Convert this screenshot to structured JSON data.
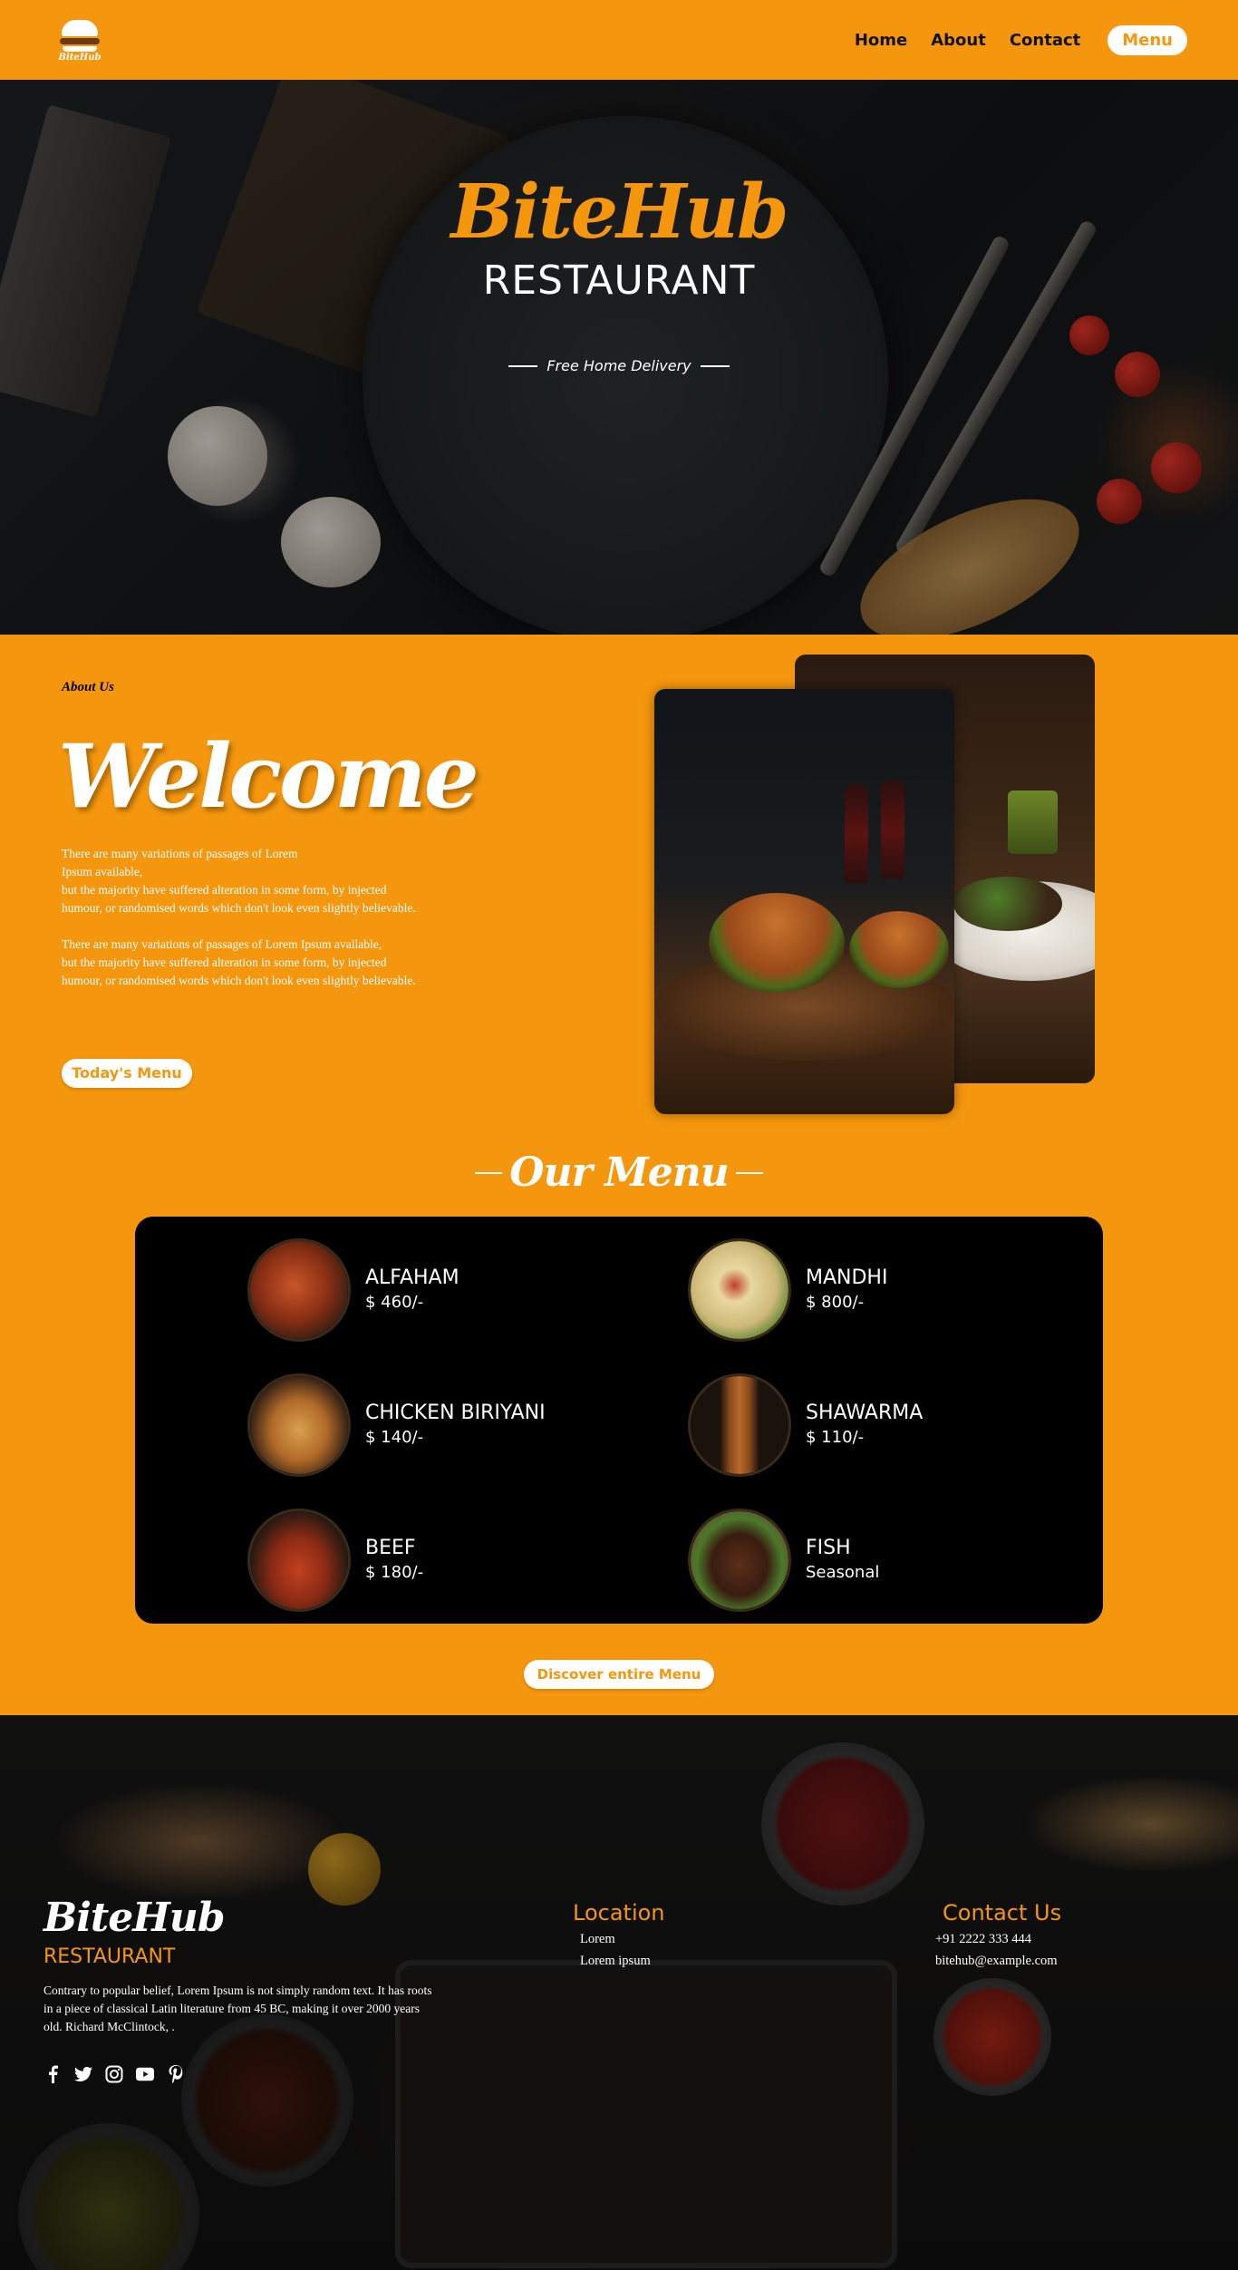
{
  "nav": {
    "logo_text": "BiteHub",
    "links": [
      "Home",
      "About",
      "Contact"
    ],
    "cta": "Menu"
  },
  "hero": {
    "title": "BiteHub",
    "subtitle": "RESTAURANT",
    "tagline": "Free Home Delivery"
  },
  "about": {
    "label": "About Us",
    "heading": "Welcome",
    "paragraph1": "There are many variations of passages of Lorem\nIpsum available,\nbut the majority have suffered alteration in some form, by injected\nhumour, or randomised words which don't look even slightly believable.",
    "paragraph2": "There are many variations of passages of Lorem Ipsum available,\nbut the majority have suffered alteration in some form, by injected\nhumour, or randomised words which don't look even slightly believable.",
    "button": "Today's Menu"
  },
  "menu": {
    "heading": "Our Menu",
    "items": [
      {
        "name": "ALFAHAM",
        "price": "$ 460/-",
        "icon": "alfaham-dish-image"
      },
      {
        "name": "MANDHI",
        "price": "$ 800/-",
        "icon": "mandhi-dish-image"
      },
      {
        "name": "CHICKEN BIRIYANI",
        "price": "$ 140/-",
        "icon": "biriyani-dish-image"
      },
      {
        "name": "SHAWARMA",
        "price": "$ 110/-",
        "icon": "shawarma-dish-image"
      },
      {
        "name": "BEEF",
        "price": "$ 180/-",
        "icon": "beef-dish-image"
      },
      {
        "name": "FISH",
        "price": "Seasonal",
        "icon": "fish-dish-image"
      }
    ],
    "button": "Discover entire Menu"
  },
  "footer": {
    "title": "BiteHub",
    "subtitle": "RESTAURANT",
    "text": "Contrary to popular belief, Lorem Ipsum is not simply random text. It has roots in a piece of classical Latin literature from 45 BC, making it over 2000 years old. Richard McClintock, .",
    "socials": [
      "facebook-icon",
      "twitter-icon",
      "instagram-icon",
      "youtube-icon",
      "pinterest-icon"
    ],
    "location": {
      "heading": "Location",
      "line1": "Lorem",
      "line2": "Lorem ipsum"
    },
    "contact": {
      "heading": "Contact Us",
      "phone": "+91 2222 333 444",
      "email": "bitehub@example.com"
    }
  },
  "colors": {
    "accent": "#f5970e",
    "menu_bg": "#000000",
    "text_light": "#ffffff"
  }
}
